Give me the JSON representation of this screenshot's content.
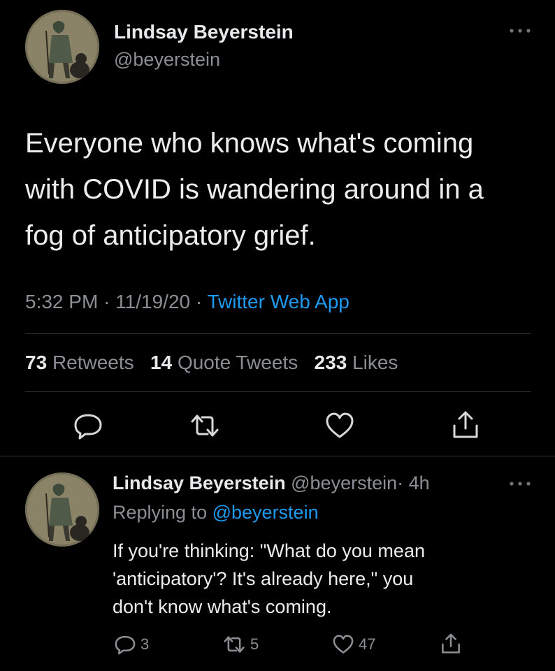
{
  "main_tweet": {
    "author_name": "Lindsay Beyerstein",
    "author_handle": "@beyerstein",
    "text_lines": [
      "Everyone who knows what's coming",
      "with COVID is wandering around in a",
      "fog of anticipatory grief."
    ],
    "time": "5:32 PM",
    "date": "11/19/20",
    "sep": "·",
    "source": "Twitter Web App",
    "retweets_count": "73",
    "retweets_label": "Retweets",
    "quotes_count": "14",
    "quotes_label": "Quote Tweets",
    "likes_count": "233",
    "likes_label": "Likes"
  },
  "reply_tweet": {
    "author_name": "Lindsay Beyerstein",
    "author_handle": "@beyerstein",
    "age": "· 4h",
    "replying_prefix": "Replying to",
    "replying_handle": "@beyerstein",
    "text_lines": [
      "If you're thinking: \"What do you mean",
      "'anticipatory'? It's already here,\" you",
      "don't know what's coming."
    ],
    "reply_count": "3",
    "retweet_count": "5",
    "like_count": "47"
  },
  "icons": {
    "more": "more-horizontal-icon",
    "reply": "reply-icon",
    "retweet": "retweet-icon",
    "like": "heart-icon",
    "share": "share-icon"
  },
  "colors": {
    "background": "#000000",
    "link": "#1d9bf0",
    "muted": "#8b8f94",
    "divider": "#2f3336"
  }
}
